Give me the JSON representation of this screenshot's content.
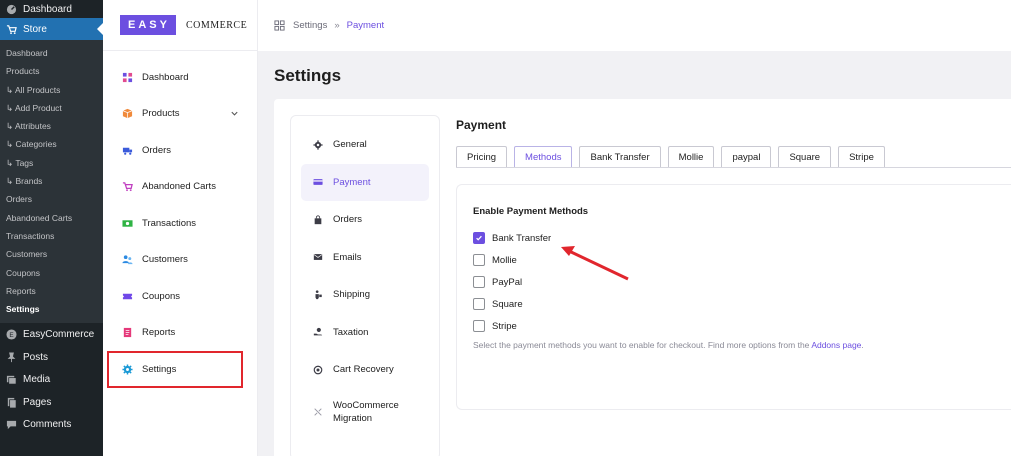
{
  "wp_menu": {
    "dashboard": "Dashboard",
    "store": "Store",
    "store_submenu": [
      "Dashboard",
      "Products",
      "↳ All Products",
      "↳ Add Product",
      "↳ Attributes",
      "↳ Categories",
      "↳ Tags",
      "↳ Brands",
      "Orders",
      "Abandoned Carts",
      "Transactions",
      "Customers",
      "Coupons",
      "Reports",
      "Settings"
    ],
    "easycommerce": "EasyCommerce",
    "posts": "Posts",
    "media": "Media",
    "pages": "Pages",
    "comments": "Comments"
  },
  "logo": {
    "box": "EASY",
    "text": "COMMERCE"
  },
  "plugin_menu": {
    "dashboard": "Dashboard",
    "products": "Products",
    "orders": "Orders",
    "abandoned_carts": "Abandoned Carts",
    "transactions": "Transactions",
    "customers": "Customers",
    "coupons": "Coupons",
    "reports": "Reports",
    "settings": "Settings"
  },
  "breadcrumb": {
    "root": "Settings",
    "separator": "»",
    "current": "Payment"
  },
  "page_title": "Settings",
  "settings_nav": {
    "general": "General",
    "payment": "Payment",
    "orders": "Orders",
    "emails": "Emails",
    "shipping": "Shipping",
    "taxation": "Taxation",
    "cart_recovery": "Cart Recovery",
    "woo_line1": "WooCommerce",
    "woo_line2": "Migration"
  },
  "payment": {
    "title": "Payment",
    "tabs": {
      "pricing": "Pricing",
      "methods": "Methods",
      "bank_transfer": "Bank Transfer",
      "mollie": "Mollie",
      "paypal": "paypal",
      "square": "Square",
      "stripe": "Stripe"
    },
    "methods_title": "Enable Payment Methods",
    "options": {
      "bank_transfer": "Bank Transfer",
      "mollie": "Mollie",
      "paypal": "PayPal",
      "square": "Square",
      "stripe": "Stripe"
    },
    "checked": {
      "bank_transfer": true,
      "mollie": false,
      "paypal": false,
      "square": false,
      "stripe": false
    },
    "help_text": "Select the payment methods you want to enable for checkout. Find more options from the ",
    "help_link": "Addons page",
    "help_end": "."
  },
  "colors": {
    "accent": "#6c4fe0",
    "wp_sidebar": "#1d2327",
    "wp_active": "#2271b1",
    "highlight": "#e1262d"
  }
}
